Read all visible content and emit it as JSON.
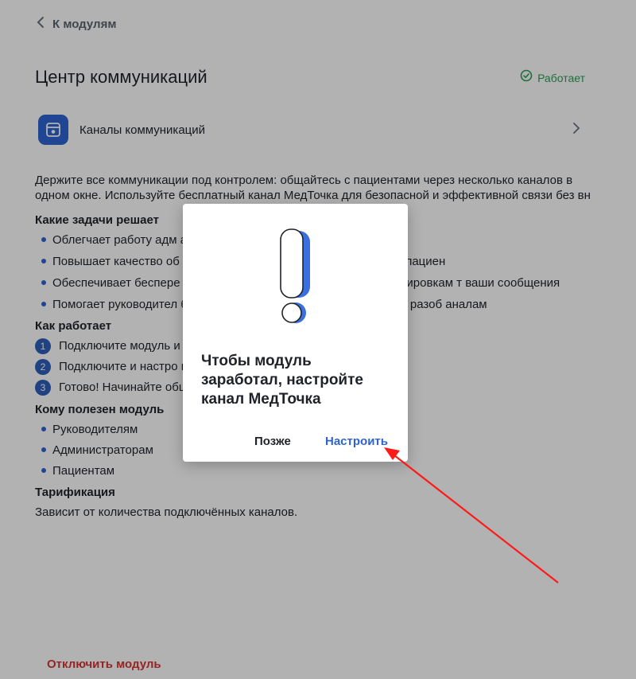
{
  "back": {
    "label": "К модулям"
  },
  "page_title": "Центр коммуникаций",
  "status": {
    "label": "Работает",
    "color": "#2f9e55"
  },
  "channels": {
    "label": "Каналы коммуникаций"
  },
  "intro": "Держите все коммуникации под контролем: общайтесь с пациентами через несколько каналов в одном окне. Используйте бесплатный канал МедТочка для безопасной и эффективной связи без вн",
  "tasks": {
    "heading": "Какие задачи решает",
    "items": [
      "Облегчает работу адм                                                  ациентами собираются в одном окне",
      "Повышает качество об                                                  ратор сможет уделить больше времени пациен",
      "Обеспечивает беспере                                                  дТочку — этот канал не подвержен блокировкам                                                   т ваши сообщения",
      "Помогает руководител                                                  бщение пошло не так, получится быстро разоб                                                   аналам"
    ]
  },
  "how": {
    "heading": "Как работает",
    "steps": [
      {
        "num": "1",
        "text": "Подключите модуль и"
      },
      {
        "num": "2",
        "text": "Подключите и настро                                                  муникации при необходимости"
      },
      {
        "num": "3",
        "text": "Готово! Начинайте общение с помощью синего виджета"
      }
    ]
  },
  "audience": {
    "heading": "Кому полезен модуль",
    "items": [
      "Руководителям",
      "Администраторам",
      "Пациентам"
    ]
  },
  "pricing": {
    "heading": "Тарификация",
    "text": "Зависит от количества подключённых каналов."
  },
  "disable_label": "Отключить модуль",
  "modal": {
    "message": "Чтобы модуль заработал, настройте канал МедТочка",
    "later_label": "Позже",
    "setup_label": "Настроить"
  },
  "colors": {
    "accent": "#2f63d1",
    "danger": "#d93434",
    "annotation_arrow": "#ff1a1a"
  }
}
